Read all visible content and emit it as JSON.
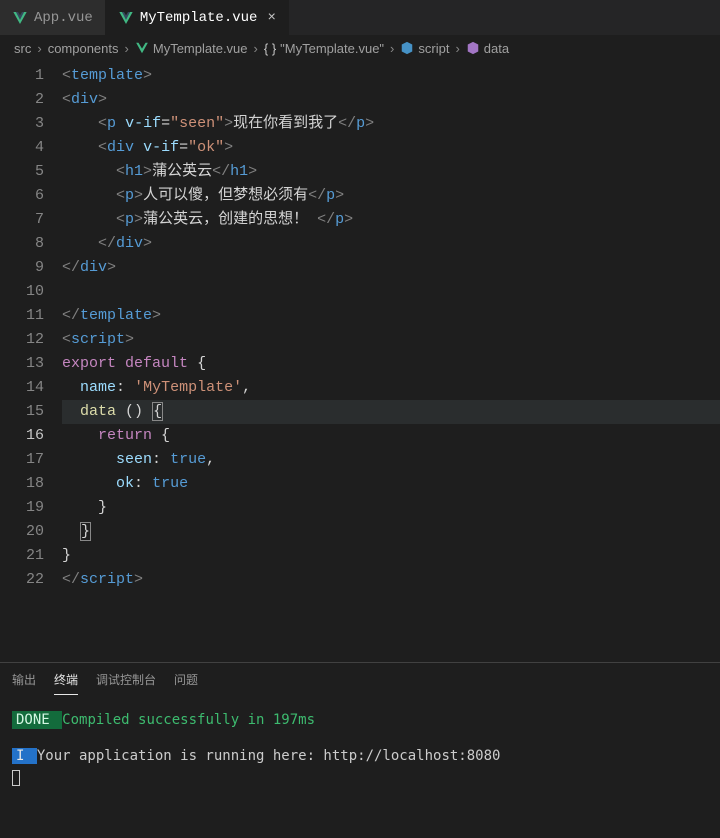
{
  "tabs": [
    {
      "label": "App.vue",
      "active": false
    },
    {
      "label": "MyTemplate.vue",
      "active": true
    }
  ],
  "breadcrumb": {
    "p0": "src",
    "p1": "components",
    "p2": "MyTemplate.vue",
    "p3": "\"MyTemplate.vue\"",
    "p4": "script",
    "p5": "data"
  },
  "lines": [
    "1",
    "2",
    "3",
    "4",
    "5",
    "6",
    "7",
    "8",
    "9",
    "10",
    "11",
    "12",
    "13",
    "14",
    "15",
    "16",
    "17",
    "18",
    "19",
    "20",
    "21",
    "22"
  ],
  "code": {
    "l1": {
      "open": "<",
      "tag": "template",
      "close": ">",
      "indent": ""
    },
    "l2": {
      "open": "<",
      "tag": "div",
      "close": ">",
      "indent": ""
    },
    "l3": {
      "indent": "    ",
      "open": "<",
      "tag": "p",
      "sp": " ",
      "attr": "v-if",
      "eq": "=",
      "val": "\"seen\"",
      "close": ">",
      "text": "现在你看到我了",
      "open2": "</",
      "tag2": "p",
      "close2": ">"
    },
    "l4": {
      "indent": "    ",
      "open": "<",
      "tag": "div",
      "sp": " ",
      "attr": "v-if",
      "eq": "=",
      "val": "\"ok\"",
      "close": ">"
    },
    "l5": {
      "indent": "      ",
      "open": "<",
      "tag": "h1",
      "close": ">",
      "text": "蒲公英云",
      "open2": "</",
      "tag2": "h1",
      "close2": ">"
    },
    "l6": {
      "indent": "      ",
      "open": "<",
      "tag": "p",
      "close": ">",
      "text": "人可以傻，但梦想必须有",
      "open2": "</",
      "tag2": "p",
      "close2": ">"
    },
    "l7": {
      "indent": "      ",
      "open": "<",
      "tag": "p",
      "close": ">",
      "text": "蒲公英云，创建的思想！ ",
      "open2": "</",
      "tag2": "p",
      "close2": ">"
    },
    "l8": {
      "indent": "    ",
      "open": "</",
      "tag": "div",
      "close": ">"
    },
    "l9": {
      "open": "</",
      "tag": "div",
      "close": ">",
      "indent": ""
    },
    "l10": {
      "blank": " "
    },
    "l11": {
      "open": "</",
      "tag": "template",
      "close": ">",
      "indent": ""
    },
    "l12": {
      "open": "<",
      "tag": "script",
      "close": ">",
      "indent": ""
    },
    "l13": {
      "indent": "",
      "kw": "export",
      "sp": " ",
      "kw2": "default",
      "sp2": " ",
      "brace": "{"
    },
    "l14": {
      "indent": "  ",
      "prop": "name",
      "colon": ":",
      "sp": " ",
      "val": "'MyTemplate'",
      "comma": ","
    },
    "l15": {
      "indent": "  ",
      "fn": "data",
      "sp": " ",
      "paren": "()",
      "sp2": " ",
      "brace": "{"
    },
    "l16": {
      "indent": "    ",
      "kw": "return",
      "sp": " ",
      "brace": "{"
    },
    "l17": {
      "indent": "      ",
      "prop": "seen",
      "colon": ":",
      "sp": " ",
      "val": "true",
      "comma": ","
    },
    "l18": {
      "indent": "      ",
      "prop": "ok",
      "colon": ":",
      "sp": " ",
      "val": "true"
    },
    "l19": {
      "indent": "    ",
      "brace": "}"
    },
    "l20": {
      "indent": "  ",
      "brace": "}"
    },
    "l21": {
      "indent": "",
      "brace": "}"
    },
    "l22": {
      "open": "</",
      "tag": "script",
      "close": ">",
      "indent": ""
    }
  },
  "panel": {
    "tabs": {
      "output": "输出",
      "terminal": "终端",
      "debug": "调试控制台",
      "problems": "问题"
    },
    "done": " DONE ",
    "compiled": "Compiled successfully in 197ms",
    "info_badge": " I ",
    "running": "Your application is running here: http://localhost:8080"
  }
}
